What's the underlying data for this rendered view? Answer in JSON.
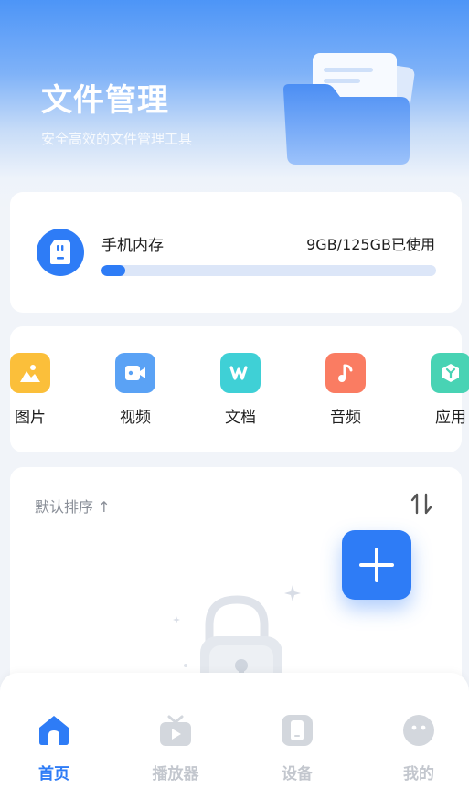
{
  "header": {
    "title": "文件管理",
    "subtitle": "安全高效的文件管理工具"
  },
  "storage": {
    "icon": "sd-card-icon",
    "label": "手机内存",
    "usage_text": "9GB/125GB已使用",
    "used_fraction": 0.072
  },
  "categories": [
    {
      "label": "图片",
      "icon": "image-icon",
      "color": "#fbbf3a"
    },
    {
      "label": "视频",
      "icon": "video-icon",
      "color": "#5aa2f5"
    },
    {
      "label": "文档",
      "icon": "document-icon",
      "color": "#3fd0d6"
    },
    {
      "label": "音频",
      "icon": "music-icon",
      "color": "#fa7c62"
    },
    {
      "label": "应用",
      "icon": "app-icon",
      "color": "#48d3b4"
    }
  ],
  "file_list": {
    "sort_label": "默认排序 ↑",
    "empty_icon": "lock-icon"
  },
  "fab": {
    "icon": "plus-icon"
  },
  "nav": [
    {
      "label": "首页",
      "icon": "home-icon",
      "active": true
    },
    {
      "label": "播放器",
      "icon": "tv-icon",
      "active": false
    },
    {
      "label": "设备",
      "icon": "phone-icon",
      "active": false
    },
    {
      "label": "我的",
      "icon": "profile-icon",
      "active": false
    }
  ],
  "colors": {
    "accent": "#2e7cf6",
    "inactive": "#c3c7ce"
  }
}
